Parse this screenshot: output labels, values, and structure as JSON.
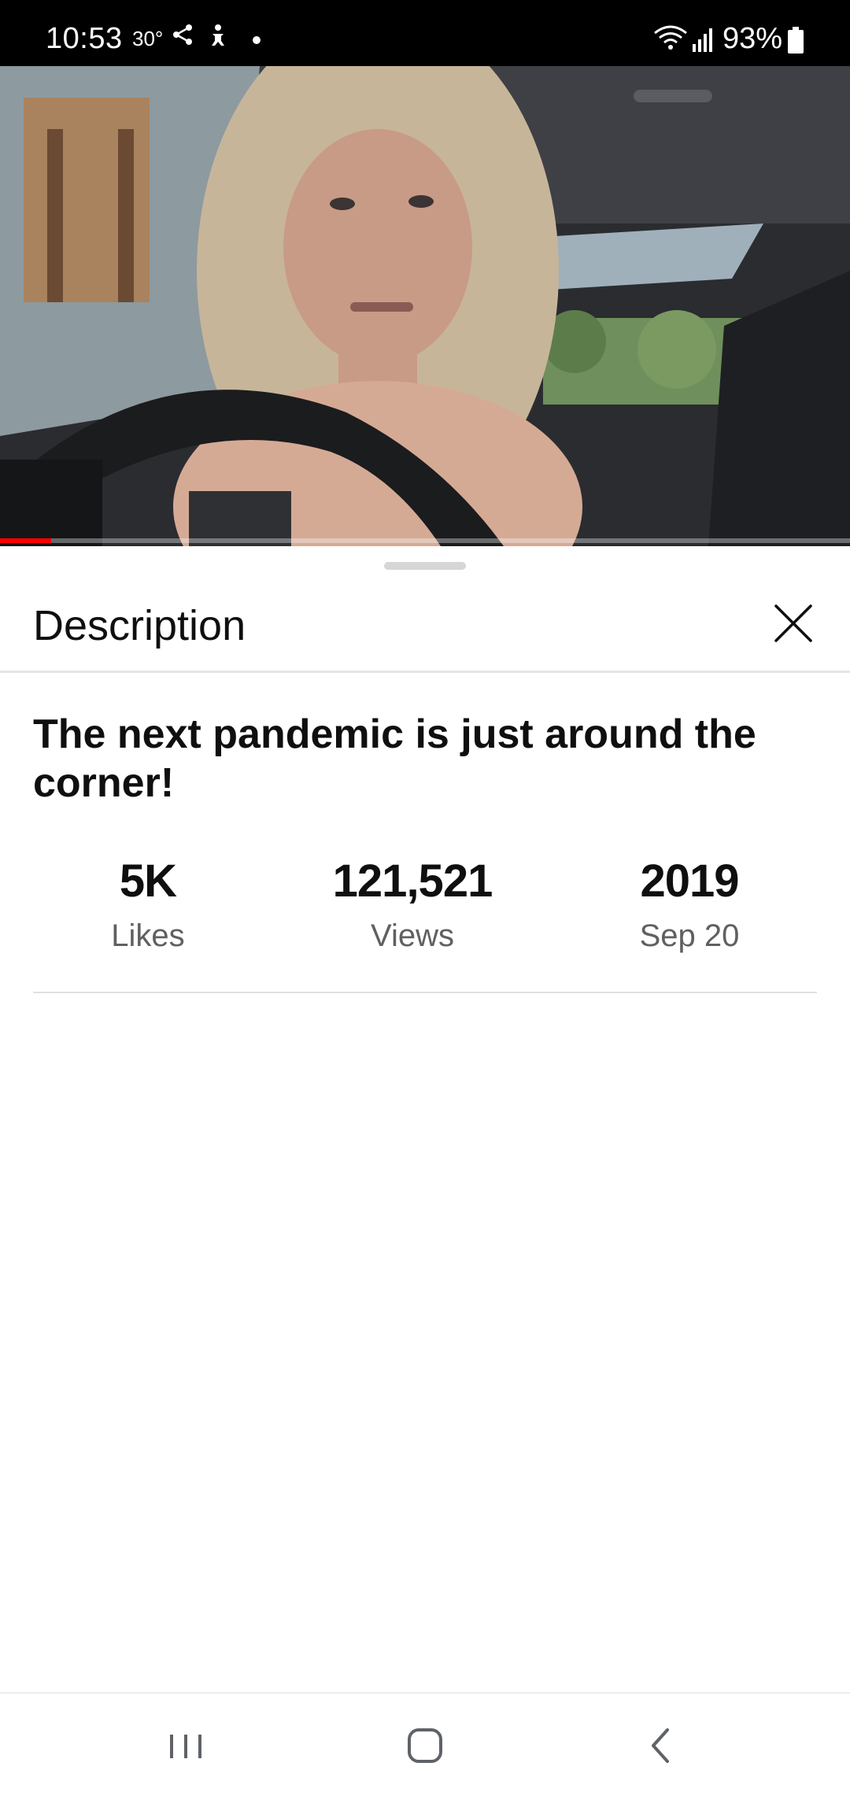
{
  "status_bar": {
    "time": "10:53",
    "temperature": "30°",
    "battery": "93%"
  },
  "player": {
    "progress_fraction": 0.06,
    "progress_color": "#ff0000"
  },
  "description_panel": {
    "title": "Description",
    "video_title": "The next pandemic is just around the corner!",
    "stats": [
      {
        "value": "5K",
        "label": "Likes"
      },
      {
        "value": "121,521",
        "label": "Views"
      },
      {
        "value": "2019",
        "label": "Sep 20"
      }
    ]
  },
  "icons": {
    "close": "close-icon",
    "share": "share-icon",
    "wifi": "wifi-icon",
    "signal": "signal-icon",
    "battery": "battery-icon",
    "recent_apps": "recent-apps-icon",
    "home": "home-icon",
    "back": "back-icon"
  }
}
